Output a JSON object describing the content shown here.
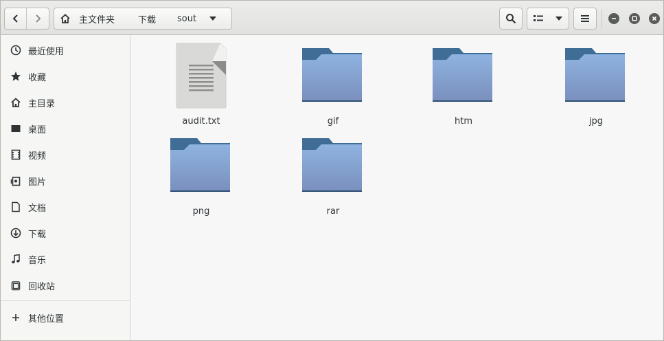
{
  "pathbar": {
    "segments": [
      "主文件夹",
      "下载",
      "sout"
    ]
  },
  "sidebar": {
    "items": [
      {
        "label": "最近使用",
        "icon": "recent-icon"
      },
      {
        "label": "收藏",
        "icon": "star-icon"
      },
      {
        "label": "主目录",
        "icon": "home-icon"
      },
      {
        "label": "桌面",
        "icon": "desktop-icon"
      },
      {
        "label": "视频",
        "icon": "video-icon"
      },
      {
        "label": "图片",
        "icon": "picture-icon"
      },
      {
        "label": "文档",
        "icon": "document-icon"
      },
      {
        "label": "下载",
        "icon": "download-icon"
      },
      {
        "label": "音乐",
        "icon": "music-icon"
      },
      {
        "label": "回收站",
        "icon": "trash-icon"
      }
    ],
    "other": {
      "label": "其他位置",
      "icon": "plus-icon"
    }
  },
  "files": [
    {
      "name": "audit.txt",
      "type": "text-file"
    },
    {
      "name": "gif",
      "type": "folder"
    },
    {
      "name": "htm",
      "type": "folder"
    },
    {
      "name": "jpg",
      "type": "folder"
    },
    {
      "name": "png",
      "type": "folder"
    },
    {
      "name": "rar",
      "type": "folder"
    }
  ],
  "colors": {
    "folder_top": "#3f6d96",
    "folder_body_top": "#8fb3e0",
    "folder_body_bottom": "#7a8fbd",
    "header_bg": "#e6e6e4",
    "sidebar_bg": "#f6f6f5"
  }
}
